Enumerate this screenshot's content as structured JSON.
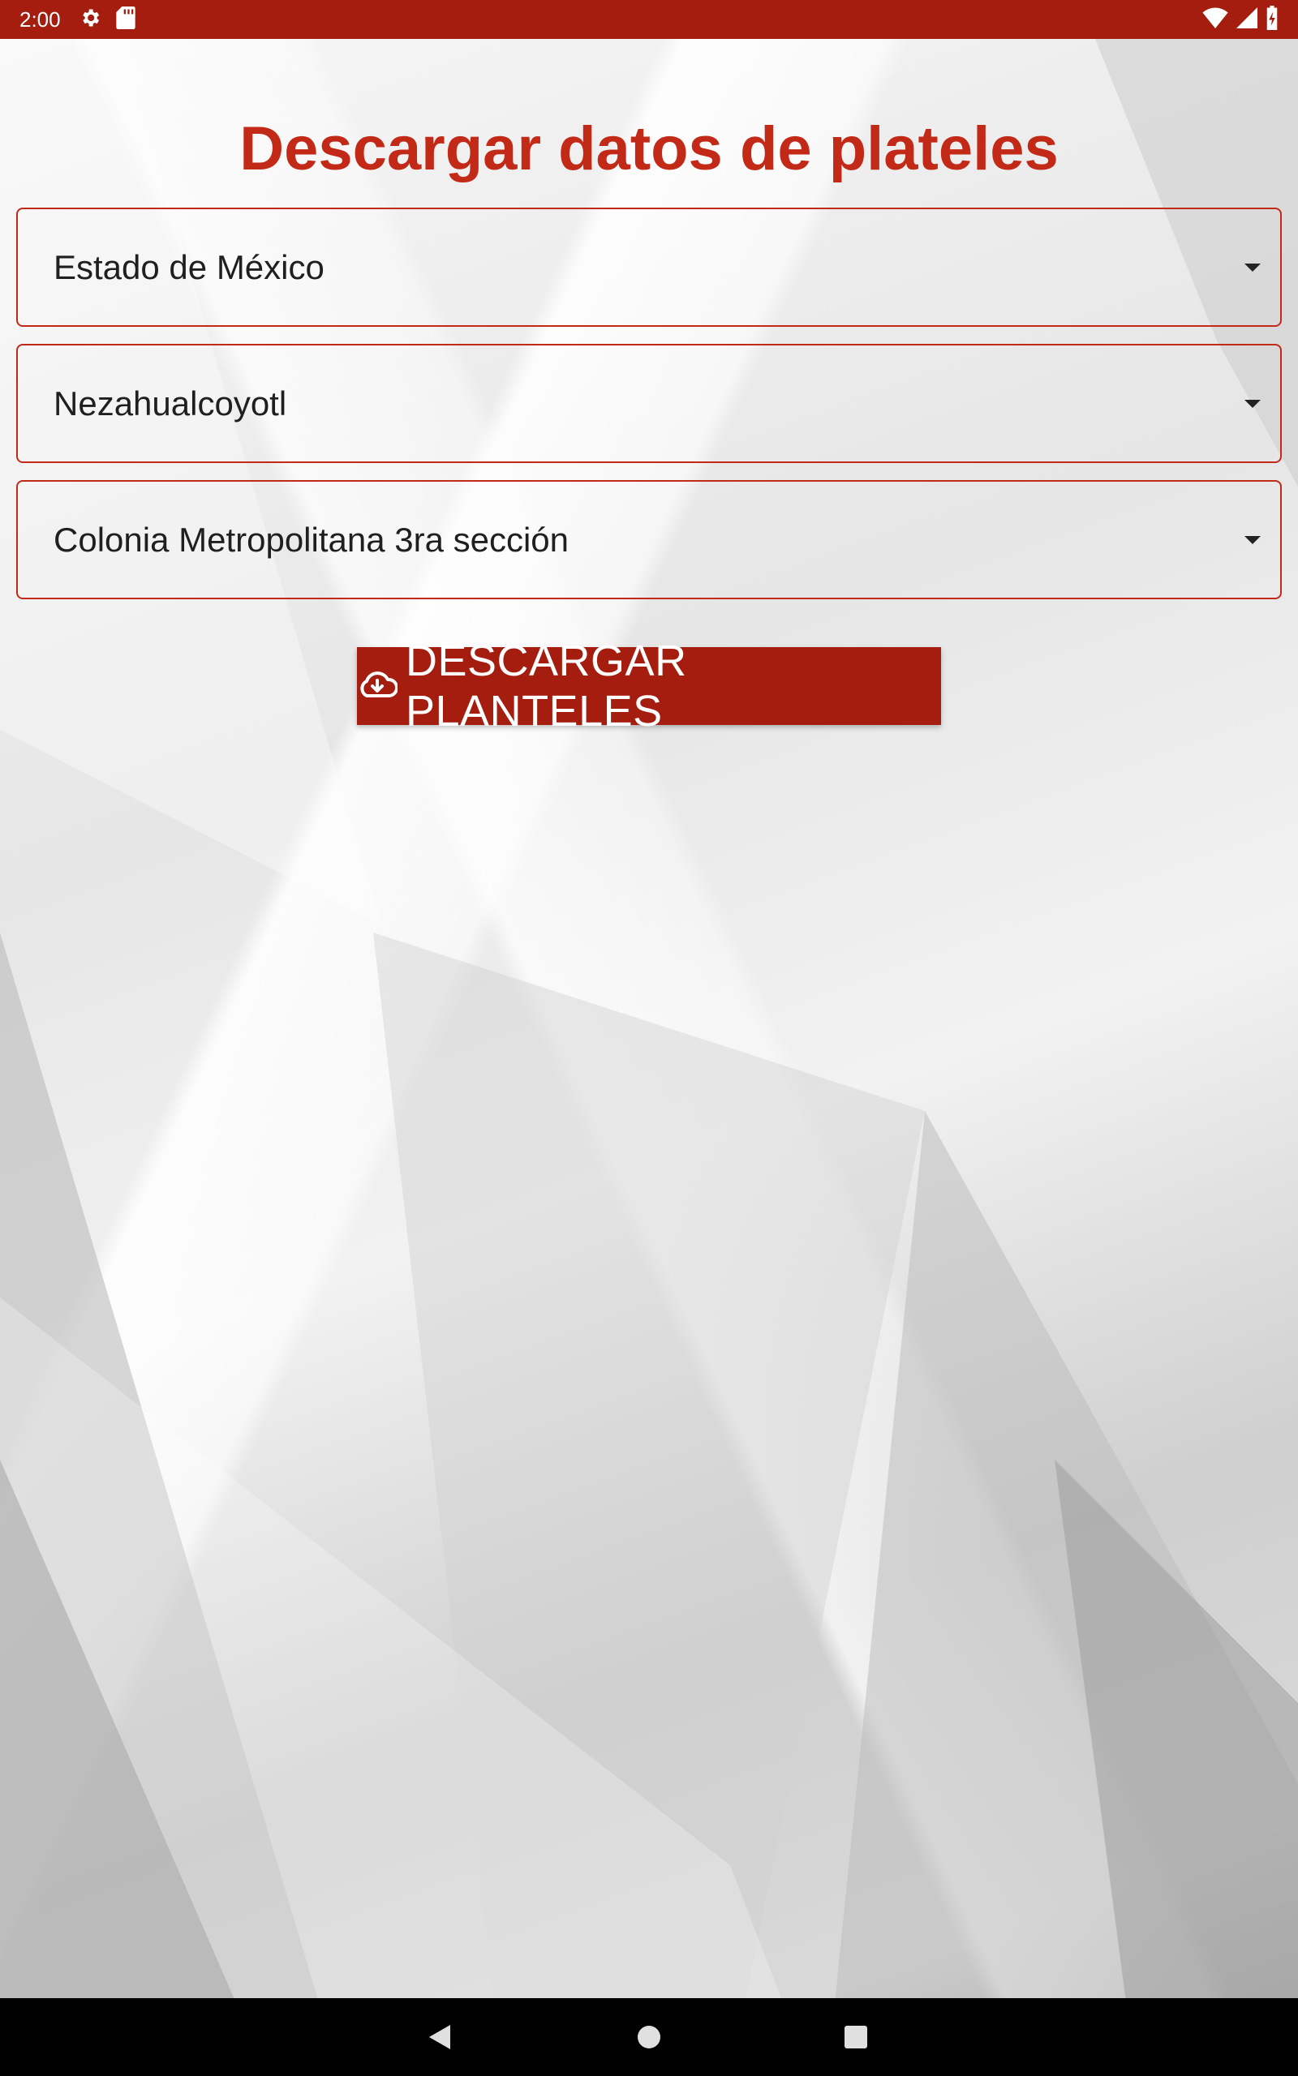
{
  "status_bar": {
    "time": "2:00",
    "left_icons": [
      "gear-icon",
      "sd-card-icon"
    ],
    "right_icons": [
      "wifi-icon",
      "cell-signal-icon",
      "battery-charging-icon"
    ],
    "color": "#a51d0f"
  },
  "page": {
    "title": "Descargar datos de plateles",
    "accent_color": "#c22a17"
  },
  "selects": {
    "estado": {
      "value": "Estado de México"
    },
    "municipio": {
      "value": "Nezahualcoyotl"
    },
    "colonia": {
      "value": "Colonia Metropolitana 3ra sección"
    }
  },
  "download_button": {
    "label": "DESCARGAR PLANTELES",
    "icon": "cloud-download-icon"
  },
  "nav_bar": {
    "buttons": [
      "back-icon",
      "home-icon",
      "recents-icon"
    ]
  }
}
